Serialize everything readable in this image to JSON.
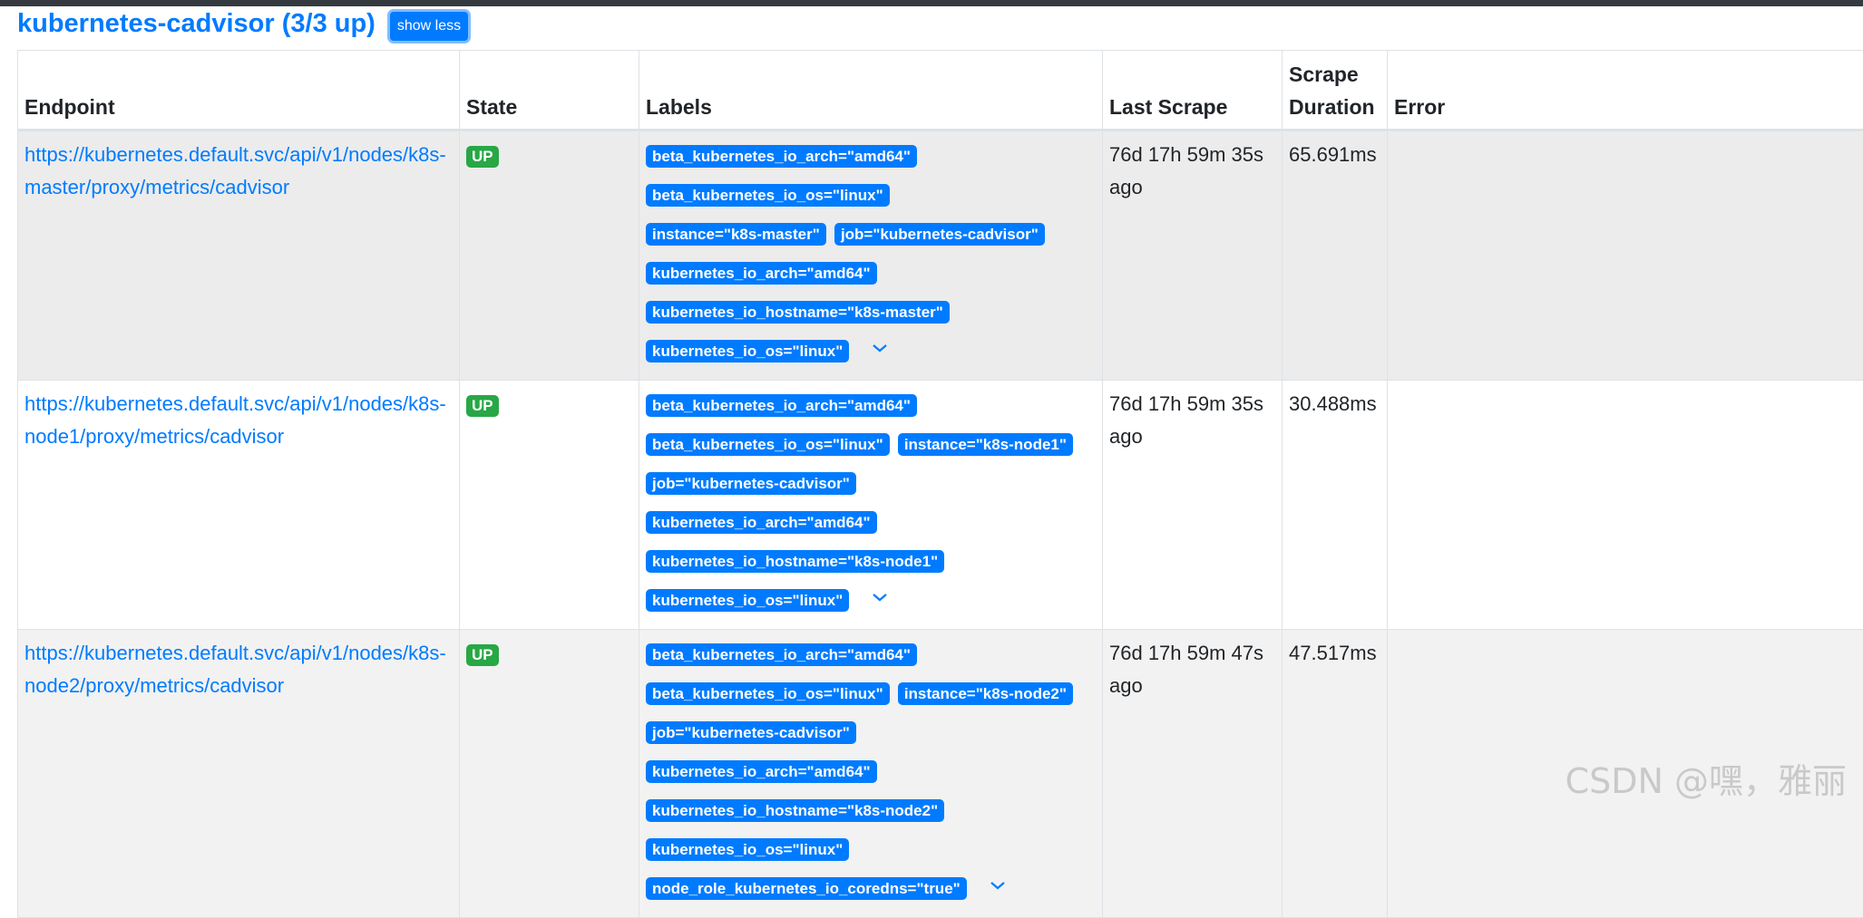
{
  "heading": {
    "title": "kubernetes-cadvisor (3/3 up)",
    "show_less_label": "show less"
  },
  "table": {
    "headers": {
      "endpoint": "Endpoint",
      "state": "State",
      "labels": "Labels",
      "last_scrape": "Last Scrape",
      "scrape_duration": "Scrape Duration",
      "error": "Error"
    },
    "rows": [
      {
        "endpoint": "https://kubernetes.default.svc/api/v1/nodes/k8s-master/proxy/metrics/cadvisor",
        "state": "UP",
        "labels": [
          "beta_kubernetes_io_arch=\"amd64\"",
          "beta_kubernetes_io_os=\"linux\"",
          "instance=\"k8s-master\"",
          "job=\"kubernetes-cadvisor\"",
          "kubernetes_io_arch=\"amd64\"",
          "kubernetes_io_hostname=\"k8s-master\"",
          "kubernetes_io_os=\"linux\""
        ],
        "last_scrape": "76d 17h 59m 35s ago",
        "scrape_duration": "65.691ms",
        "error": ""
      },
      {
        "endpoint": "https://kubernetes.default.svc/api/v1/nodes/k8s-node1/proxy/metrics/cadvisor",
        "state": "UP",
        "labels": [
          "beta_kubernetes_io_arch=\"amd64\"",
          "beta_kubernetes_io_os=\"linux\"",
          "instance=\"k8s-node1\"",
          "job=\"kubernetes-cadvisor\"",
          "kubernetes_io_arch=\"amd64\"",
          "kubernetes_io_hostname=\"k8s-node1\"",
          "kubernetes_io_os=\"linux\""
        ],
        "last_scrape": "76d 17h 59m 35s ago",
        "scrape_duration": "30.488ms",
        "error": ""
      },
      {
        "endpoint": "https://kubernetes.default.svc/api/v1/nodes/k8s-node2/proxy/metrics/cadvisor",
        "state": "UP",
        "labels": [
          "beta_kubernetes_io_arch=\"amd64\"",
          "beta_kubernetes_io_os=\"linux\"",
          "instance=\"k8s-node2\"",
          "job=\"kubernetes-cadvisor\"",
          "kubernetes_io_arch=\"amd64\"",
          "kubernetes_io_hostname=\"k8s-node2\"",
          "kubernetes_io_os=\"linux\"",
          "node_role_kubernetes_io_coredns=\"true\""
        ],
        "last_scrape": "76d 17h 59m 47s ago",
        "scrape_duration": "47.517ms",
        "error": ""
      }
    ]
  },
  "watermark": "CSDN @嘿，雅丽",
  "icons": {
    "expand": "chevron-down-icon"
  },
  "colors": {
    "primary": "#007bff",
    "success": "#28a745",
    "header_bar": "#343a40"
  }
}
